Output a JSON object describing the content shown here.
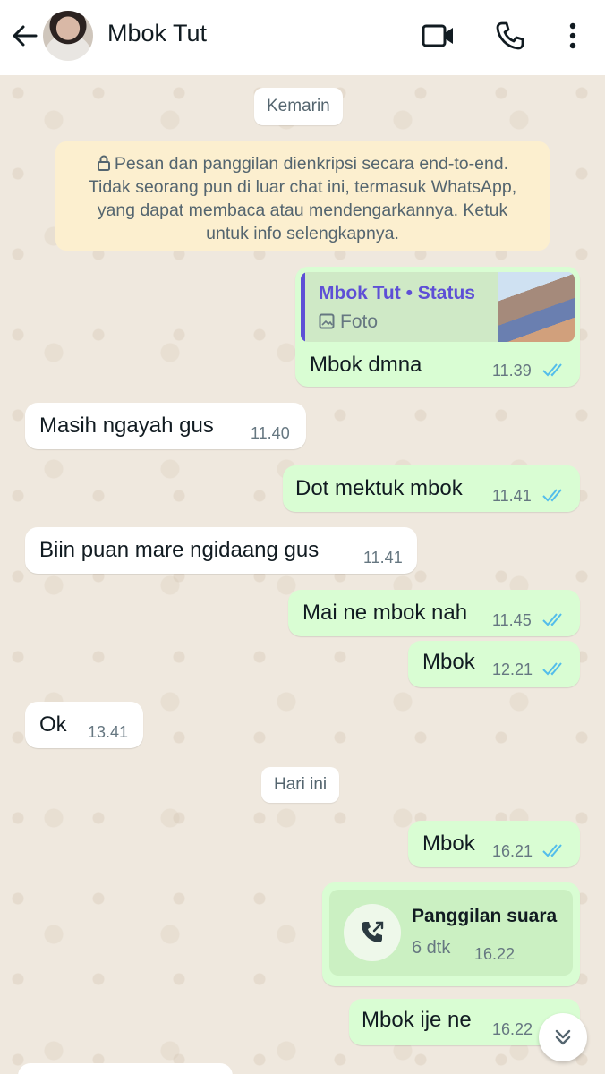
{
  "header": {
    "contact_name": "Mbok Tut",
    "icons": [
      "back-arrow-icon",
      "video-call-icon",
      "voice-call-icon",
      "more-options-icon"
    ]
  },
  "chat": {
    "date_yesterday": "Kemarin",
    "encryption_notice": [
      "Pesan dan panggilan dienkripsi secara end-to-end.",
      "Tidak seorang pun di luar chat ini, termasuk WhatsApp,",
      "yang dapat membaca atau mendengarkannya. Ketuk",
      "untuk info selengkapnya."
    ],
    "date_today": "Hari ini",
    "messages": [
      {
        "dir": "out",
        "reply_name": "Mbok Tut • Status",
        "reply_sub": "Foto",
        "text": "Mbok dmna",
        "time": "11.39"
      },
      {
        "dir": "in",
        "text": "Masih ngayah gus",
        "time": "11.40"
      },
      {
        "dir": "out",
        "text": "Dot mektuk mbok",
        "time": "11.41"
      },
      {
        "dir": "in",
        "text": "Biin puan mare ngidaang gus",
        "time": "11.41"
      },
      {
        "dir": "out",
        "text": "Mai ne mbok nah",
        "time": "11.45"
      },
      {
        "dir": "out",
        "text": "Mbok",
        "time": "12.21"
      },
      {
        "dir": "in",
        "text": "Ok",
        "time": "13.41"
      },
      {
        "dir": "out",
        "text": "Mbok",
        "time": "16.21"
      },
      {
        "dir": "out",
        "call_title": "Panggilan suara",
        "call_duration": "6 dtk",
        "time": "16.22"
      },
      {
        "dir": "out",
        "text": "Mbok ije ne",
        "time": "16.22"
      }
    ]
  },
  "colors": {
    "outgoing_bubble": "#d9fdd3",
    "incoming_bubble": "#ffffff",
    "read_ticks": "#53bdeb",
    "reply_accent": "#5e4fd6",
    "encryption_bg": "#fcefcf"
  }
}
